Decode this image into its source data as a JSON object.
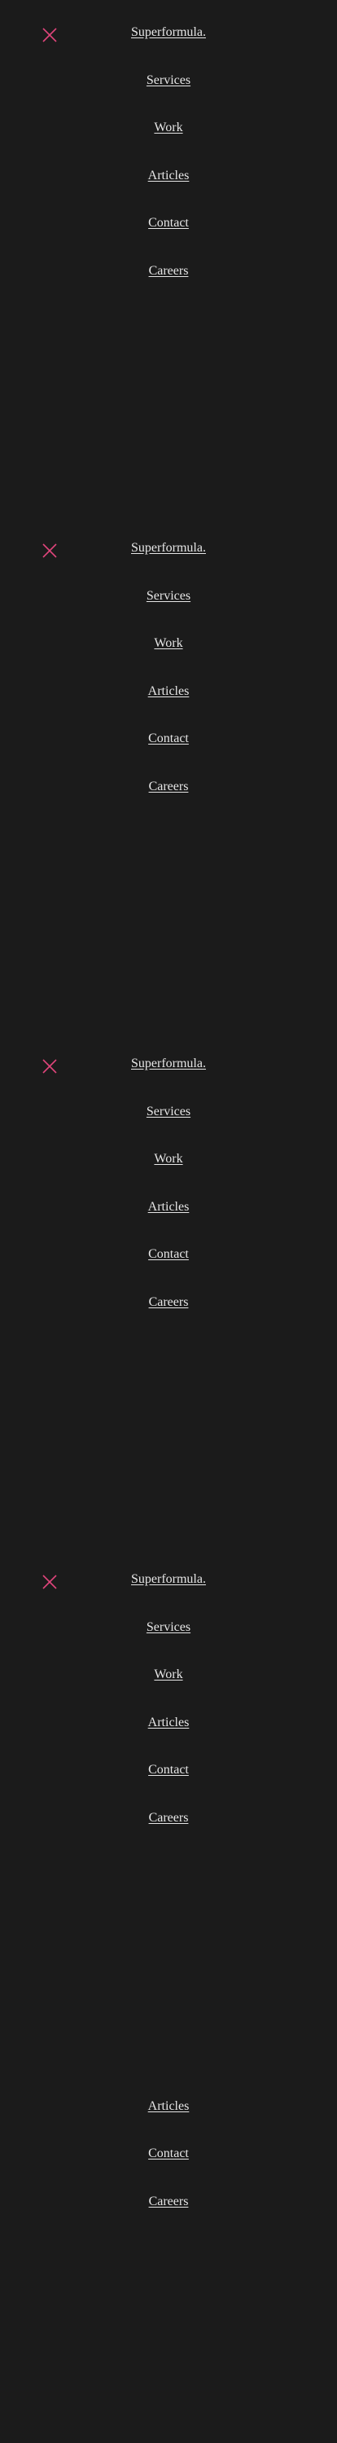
{
  "accent_color": "#e0457b",
  "close_icon": "close-icon",
  "menu": {
    "brand": "Superformula.",
    "items": [
      {
        "label": "Services"
      },
      {
        "label": "Work"
      },
      {
        "label": "Articles"
      },
      {
        "label": "Contact"
      },
      {
        "label": "Careers"
      }
    ]
  }
}
